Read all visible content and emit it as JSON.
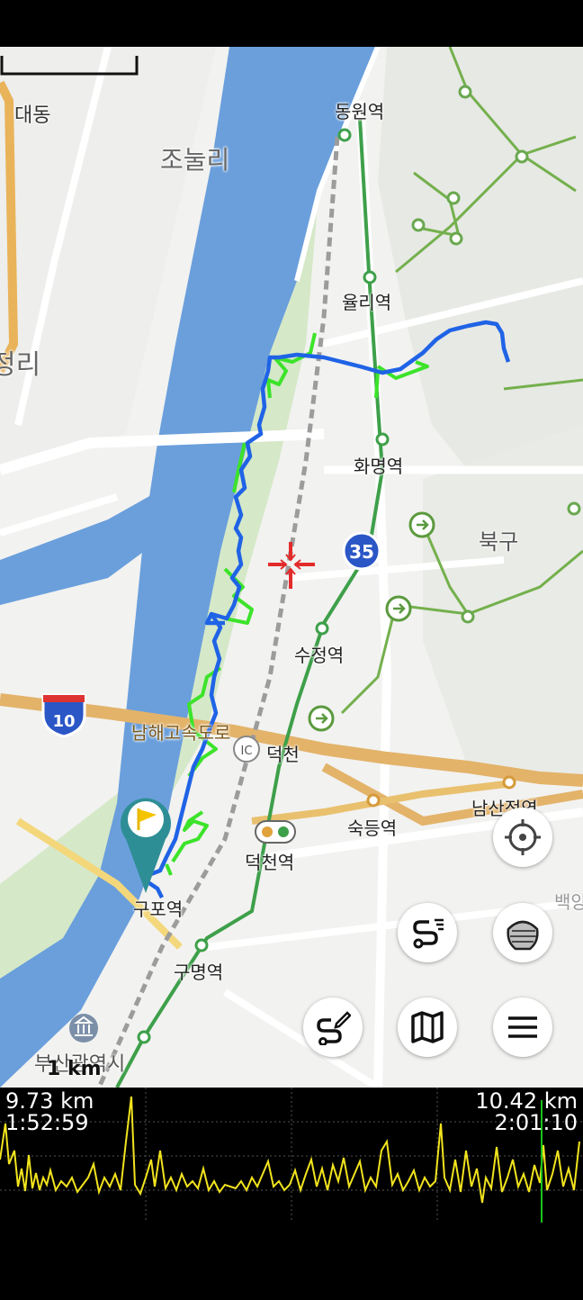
{
  "map": {
    "labels": {
      "daedong": "대동",
      "jonulli": "조눌리",
      "jeongri": "정리",
      "dongwon": "동원역",
      "yulli": "율리역",
      "hwamyeong": "화명역",
      "bukgu": "북구",
      "sujeong": "수정역",
      "deokcheon": "덕천",
      "deokcheon_station": "덕천역",
      "sukdeung": "숙등역",
      "namsanjeong": "남산정역",
      "gupo": "구포역",
      "gumyeong": "구명역",
      "busan_city": "부산광역시",
      "baek": "백양",
      "namhae_expressway": "남해고속도로",
      "ic_badge": "IC"
    },
    "route_35": "35",
    "route_10": "10",
    "scale_label": "1 km"
  },
  "buttons": [
    {
      "name": "locate-button",
      "icon": "crosshair-icon"
    },
    {
      "name": "track-list-button",
      "icon": "track-list-icon"
    },
    {
      "name": "layers-button",
      "icon": "layers-icon"
    },
    {
      "name": "edit-track-button",
      "icon": "edit-track-icon"
    },
    {
      "name": "map-button",
      "icon": "map-icon"
    },
    {
      "name": "menu-button",
      "icon": "menu-icon"
    }
  ],
  "elevation": {
    "left_distance": "9.73 km",
    "left_time": "1:52:59",
    "right_distance": "10.42 km",
    "right_time": "2:01:10",
    "line_color": "#f2e41e",
    "cursor_color": "#19c319"
  },
  "colors": {
    "river": "#6a9fdc",
    "park": "#d9ead0",
    "track_blue": "#1f63e6",
    "track_green": "#39e026",
    "railway": "#9a9a9a",
    "highway": "#e3b36a",
    "trail": "#6aa84f"
  }
}
